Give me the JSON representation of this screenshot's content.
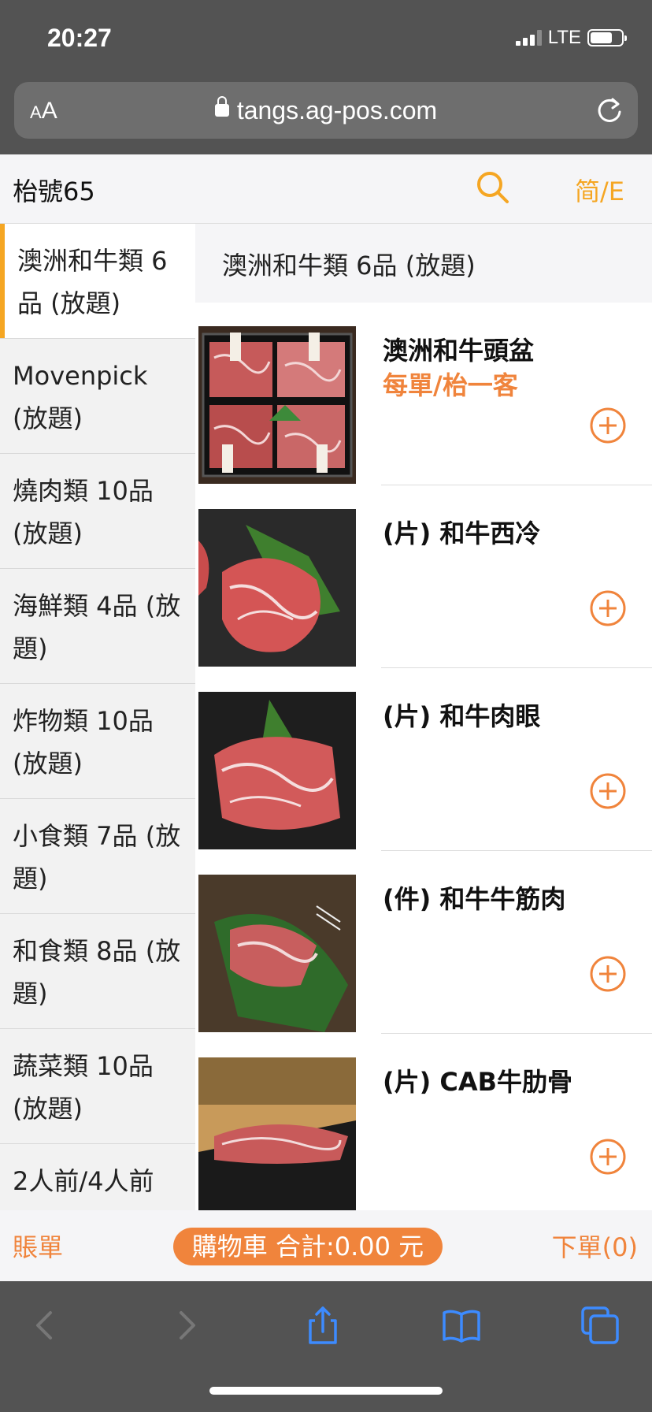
{
  "status": {
    "time": "20:27",
    "network": "LTE"
  },
  "browser": {
    "text_size_small": "A",
    "text_size_large": "A",
    "url": "tangs.ag-pos.com"
  },
  "header": {
    "store_name": "枱號65",
    "lang_label": "简/E"
  },
  "sidebar": {
    "categories": [
      {
        "label": "澳洲和牛類 6品 (放題)"
      },
      {
        "label": "Movenpick (放題)"
      },
      {
        "label": "燒肉類 10品 (放題)"
      },
      {
        "label": "海鮮類 4品 (放題)"
      },
      {
        "label": "炸物類 10品 (放題)"
      },
      {
        "label": "小食類 7品 (放題)"
      },
      {
        "label": "和食類 8品 (放題)"
      },
      {
        "label": "蔬菜類 10品 (放題)"
      },
      {
        "label": "2人前/4人前"
      }
    ]
  },
  "main": {
    "section_title": "澳洲和牛類 6品 (放題)",
    "items": [
      {
        "name": "澳洲和牛頭盆",
        "note": "每單/枱一客"
      },
      {
        "name": "(片) 和牛西冷",
        "note": ""
      },
      {
        "name": "(片) 和牛肉眼",
        "note": ""
      },
      {
        "name": "(件) 和牛牛筋肉",
        "note": ""
      },
      {
        "name": "(片) CAB牛肋骨",
        "note": ""
      }
    ]
  },
  "bottom_bar": {
    "bill_label": "賬單",
    "cart_label": "購物車 合計:0.00 元",
    "order_label": "下單(0)"
  },
  "colors": {
    "accent": "#f5a623",
    "order_orange": "#f0843c"
  },
  "icons": [
    "search-icon",
    "add-icon",
    "lock-icon",
    "reload-icon",
    "back-icon",
    "forward-icon",
    "share-icon",
    "bookmarks-icon",
    "tabs-icon"
  ]
}
